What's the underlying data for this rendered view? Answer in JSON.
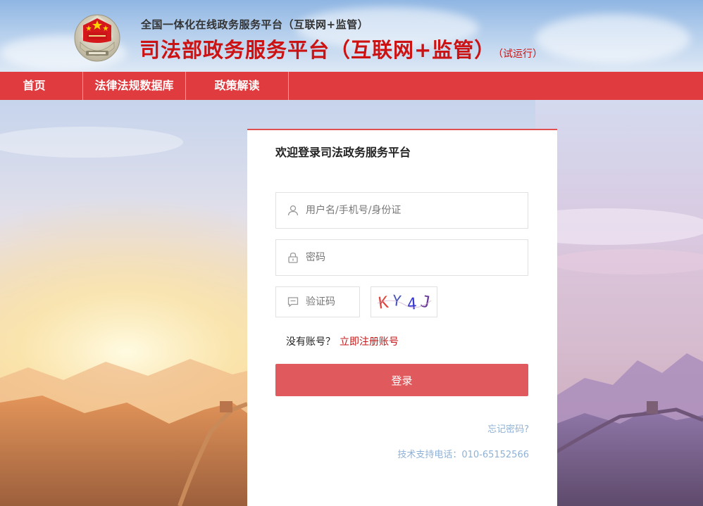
{
  "header": {
    "super_title": "全国一体化在线政务服务平台（互联网+监管）",
    "main_title": "司法部政务服务平台（互联网+监管）",
    "trial_tag": "（试运行）"
  },
  "nav": {
    "items": [
      {
        "label": "首页"
      },
      {
        "label": "法律法规数据库"
      },
      {
        "label": "政策解读"
      }
    ]
  },
  "login": {
    "title": "欢迎登录司法政务服务平台",
    "username_placeholder": "用户名/手机号/身份证",
    "password_placeholder": "密码",
    "captcha_placeholder": "验证码",
    "captcha_text": "KY4J",
    "no_account": "没有账号？",
    "register_link": "立即注册账号",
    "login_button": "登录",
    "forgot_password": "忘记密码?",
    "support_phone": "技术支持电话：010-65152566"
  },
  "colors": {
    "brand_red": "#e03b3f",
    "title_red": "#cc1212",
    "button_red": "#e05a5d",
    "link_blue": "#8fb1d6"
  },
  "icons": {
    "username": "user-icon",
    "password": "lock-icon",
    "captcha": "message-icon",
    "emblem": "justice-emblem-icon"
  }
}
